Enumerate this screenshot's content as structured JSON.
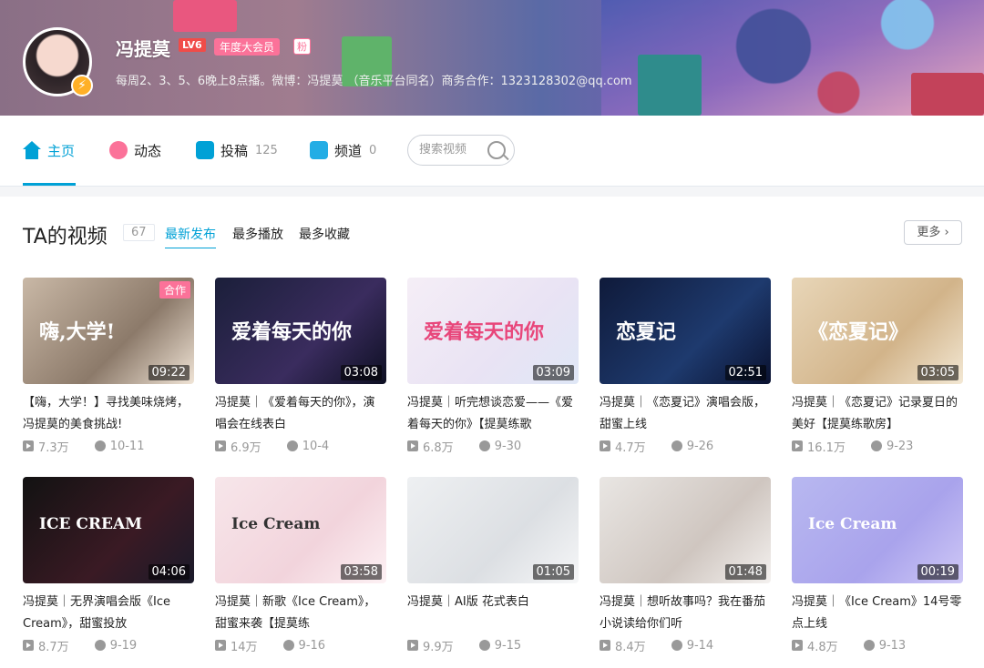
{
  "header": {
    "username": "冯提莫",
    "level": "LV6",
    "vip_label": "年度大会员",
    "fan_label": "粉",
    "sign": "每周2、3、5、6晚上8点播。微博：冯提莫 （音乐平台同名）商务合作：1323128302@qq.com"
  },
  "nav": {
    "tabs": [
      {
        "label": "主页",
        "count": ""
      },
      {
        "label": "动态",
        "count": ""
      },
      {
        "label": "投稿",
        "count": "125"
      },
      {
        "label": "频道",
        "count": "0"
      }
    ],
    "search_placeholder": "搜索视频",
    "accent": "#00a1d6"
  },
  "videos_section": {
    "title": "TA的视频",
    "count": "67",
    "sorts": [
      "最新发布",
      "最多播放",
      "最多收藏"
    ],
    "more_label": "更多"
  },
  "videos": [
    {
      "title": "【嗨，大学！】寻找美味烧烤，冯提莫的美食挑战!",
      "duration": "09:22",
      "views": "7.3万",
      "date": "10-11",
      "tag": "合作",
      "thumb_text": "嗨,大学!"
    },
    {
      "title": "冯提莫｜《爱着每天的你》，演唱会在线表白",
      "duration": "03:08",
      "views": "6.9万",
      "date": "10-4",
      "tag": "",
      "thumb_text": "爱着每天的你"
    },
    {
      "title": "冯提莫｜听完想谈恋爱——《爱着每天的你》【提莫练歌",
      "duration": "03:09",
      "views": "6.8万",
      "date": "9-30",
      "tag": "",
      "thumb_text": "爱着每天的你"
    },
    {
      "title": "冯提莫｜《恋夏记》演唱会版，甜蜜上线",
      "duration": "02:51",
      "views": "4.7万",
      "date": "9-26",
      "tag": "",
      "thumb_text": "恋夏记"
    },
    {
      "title": "冯提莫｜《恋夏记》记录夏日的美好【提莫练歌房】",
      "duration": "03:05",
      "views": "16.1万",
      "date": "9-23",
      "tag": "",
      "thumb_text": "《恋夏记》"
    },
    {
      "title": "冯提莫｜无界演唱会版《Ice Cream》，甜蜜投放",
      "duration": "04:06",
      "views": "8.7万",
      "date": "9-19",
      "tag": "",
      "thumb_text": "ICE CREAM"
    },
    {
      "title": "冯提莫｜新歌《Ice Cream》，甜蜜来袭【提莫练",
      "duration": "03:58",
      "views": "14万",
      "date": "9-16",
      "tag": "",
      "thumb_text": "Ice Cream"
    },
    {
      "title": "冯提莫｜AI版 花式表白",
      "duration": "01:05",
      "views": "9.9万",
      "date": "9-15",
      "tag": "",
      "thumb_text": ""
    },
    {
      "title": "冯提莫｜想听故事吗？我在番茄小说读给你们听",
      "duration": "01:48",
      "views": "8.4万",
      "date": "9-14",
      "tag": "",
      "thumb_text": ""
    },
    {
      "title": "冯提莫｜《Ice Cream》14号零点上线",
      "duration": "00:19",
      "views": "4.8万",
      "date": "9-13",
      "tag": "",
      "thumb_text": "Ice Cream"
    }
  ]
}
